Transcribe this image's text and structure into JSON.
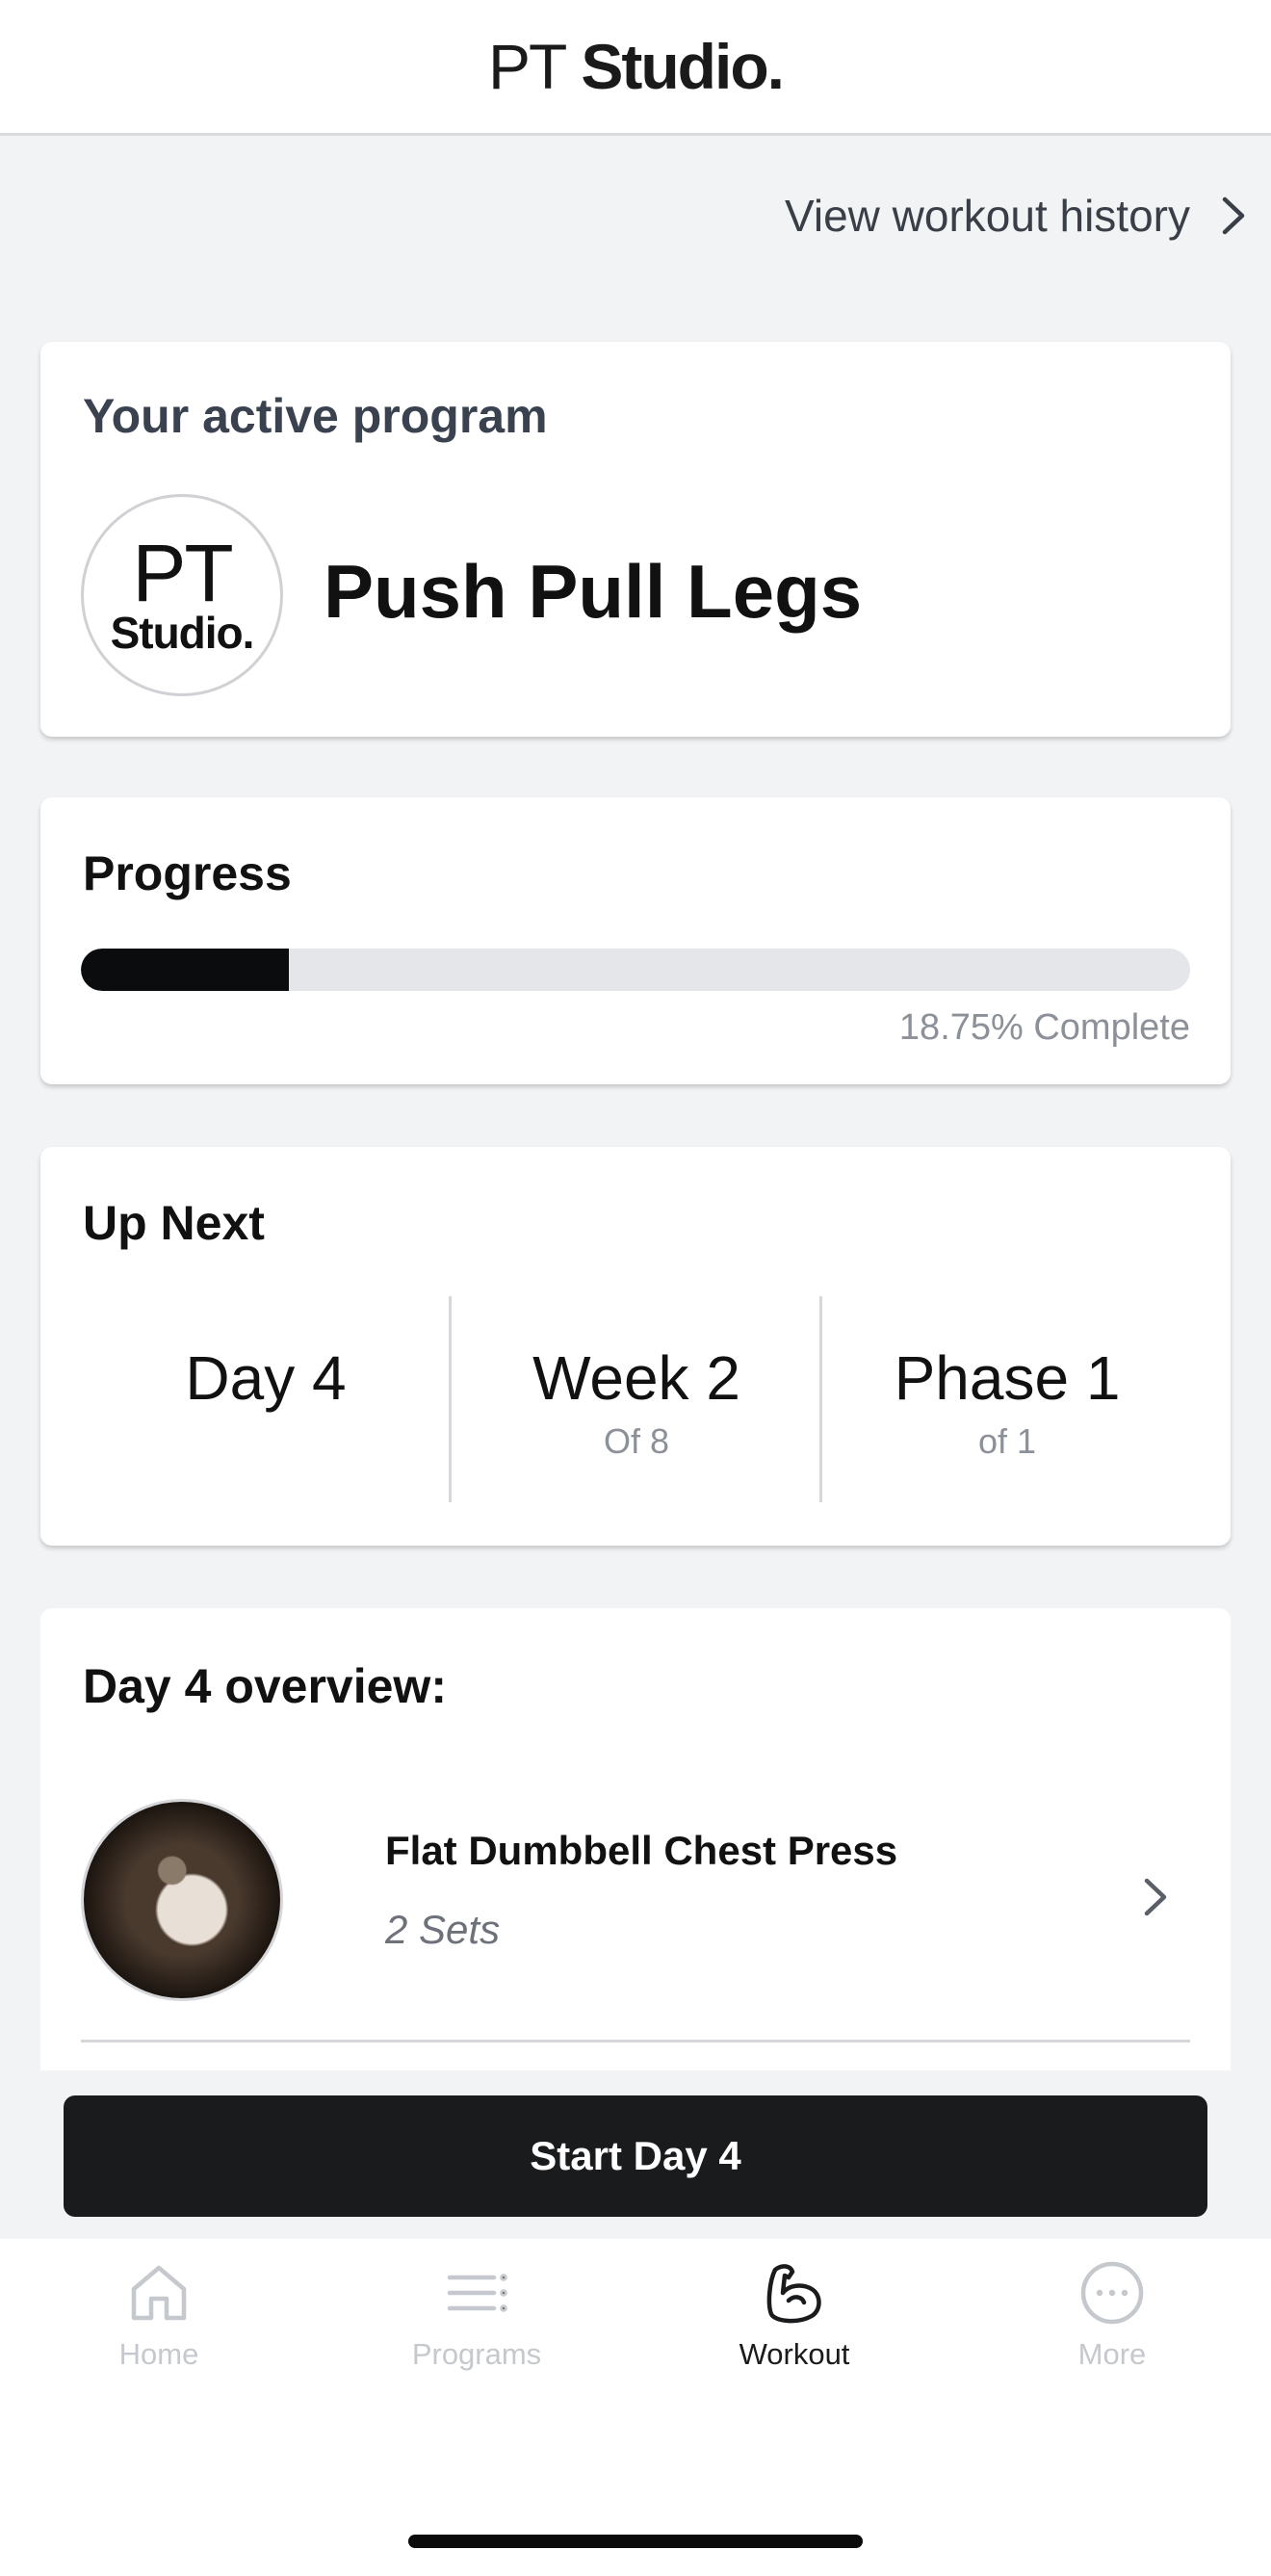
{
  "header": {
    "brand_pt": "PT",
    "brand_studio": "Studio."
  },
  "history_link": {
    "label": "View workout history"
  },
  "active_program": {
    "title": "Your active program",
    "logo_line1": "PT",
    "logo_line2": "Studio.",
    "name": "Push Pull Legs"
  },
  "progress": {
    "title": "Progress",
    "percent": 18.75,
    "label": "18.75% Complete"
  },
  "up_next": {
    "title": "Up Next",
    "day": {
      "value": "Day 4",
      "sub": ""
    },
    "week": {
      "value": "Week 2",
      "sub": "Of 8"
    },
    "phase": {
      "value": "Phase 1",
      "sub": "of 1"
    }
  },
  "overview": {
    "title": "Day 4 overview:",
    "exercises": [
      {
        "name": "Flat Dumbbell Chest Press",
        "sets": "2 Sets"
      }
    ]
  },
  "start_button": {
    "label": "Start Day 4"
  },
  "tabbar": {
    "items": [
      {
        "label": "Home",
        "icon": "home-icon",
        "active": false
      },
      {
        "label": "Programs",
        "icon": "list-icon",
        "active": false
      },
      {
        "label": "Workout",
        "icon": "flexed-bicep-icon",
        "active": true
      },
      {
        "label": "More",
        "icon": "more-dots-icon",
        "active": false
      }
    ]
  },
  "colors": {
    "background": "#f2f3f5",
    "card": "#ffffff",
    "primary_dark": "#1a1b1d",
    "progress_track": "#e4e6e9",
    "muted_text": "#8c9098",
    "inactive_tab": "#c5c8cd"
  }
}
